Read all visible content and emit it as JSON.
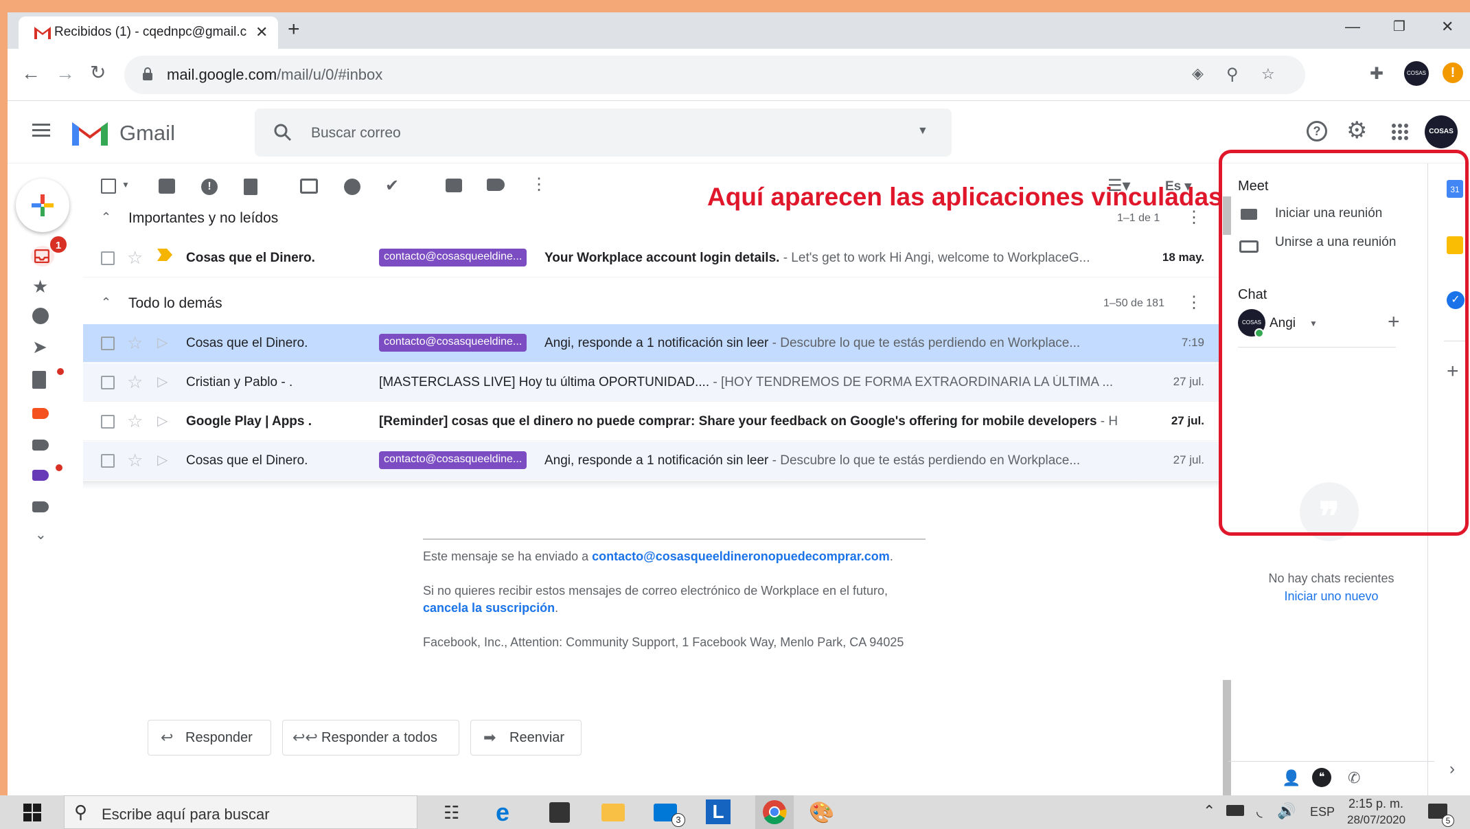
{
  "browser": {
    "tab_title": "Recibidos (1) - cqednpc@gmail.c",
    "url_host": "mail.google.com",
    "url_path": "/mail/u/0/#inbox"
  },
  "gmail": {
    "logo_text": "Gmail",
    "search_placeholder": "Buscar correo",
    "inbox_badge": "1",
    "toolbar": {
      "density_label": "Es"
    },
    "sections": [
      {
        "title": "Importantes y no leídos",
        "count": "1–1 de 1"
      },
      {
        "title": "Todo lo demás",
        "count": "1–50 de 181"
      }
    ],
    "important_rows": [
      {
        "sender": "Cosas que el Dinero.",
        "label": "contacto@cosasqueeldine...",
        "subject": "Your Workplace account login details.",
        "snippet": " - Let's get to work Hi Angi, welcome to WorkplaceG...",
        "date": "18 may."
      }
    ],
    "other_rows": [
      {
        "sender": "Cosas que el Dinero.",
        "label": "contacto@cosasqueeldine...",
        "subject": "Angi, responde a 1 notificación sin leer",
        "snippet": " - Descubre lo que te estás perdiendo en Workplace...",
        "date": "7:19"
      },
      {
        "sender": "Cristian y Pablo - .",
        "label": "",
        "subject": "[MASTERCLASS LIVE] Hoy tu última OPORTUNIDAD....",
        "snippet": " - [HOY TENDREMOS DE FORMA EXTRAORDINARIA LA ÚLTIMA ...",
        "date": "27 jul."
      },
      {
        "sender_bold": "Google Play",
        "sender_rest": " | Apps .",
        "label": "",
        "subject": "[Reminder] cosas que el dinero no puede comprar: Share your feedback on Google's offering for mobile developers",
        "snippet": " - H",
        "date": "27 jul."
      },
      {
        "sender": "Cosas que el Dinero.",
        "label": "contacto@cosasqueeldine...",
        "subject": "Angi, responde a 1 notificación sin leer",
        "snippet": " - Descubre lo que te estás perdiendo en Workplace...",
        "date": "27 jul."
      }
    ],
    "footer": {
      "sent_to_prefix": "Este mensaje se ha enviado a ",
      "sent_to_email": "contacto@cosasqueeldineronopuedecomprar.com",
      "sent_to_suffix": ".",
      "unsub_text": "Si no quieres recibir estos mensajes de correo electrónico de Workplace en el futuro, ",
      "unsub_link": "cancela la suscripción",
      "unsub_suffix": ".",
      "address": "Facebook, Inc., Attention: Community Support, 1 Facebook Way, Menlo Park, CA 94025"
    },
    "actions": {
      "reply": "Responder",
      "reply_all": "Responder a todos",
      "forward": "Reenviar"
    },
    "side": {
      "meet_title": "Meet",
      "meet_start": "Iniciar una reunión",
      "meet_join": "Unirse a una reunión",
      "chat_title": "Chat",
      "chat_user": "Angi",
      "no_chats": "No hay chats recientes",
      "start_new": "Iniciar uno nuevo"
    },
    "annotation": "Aquí aparecen las aplicaciones vinculadas",
    "avatar_text": "COSAS"
  },
  "taskbar": {
    "search_placeholder": "Escribe aquí para buscar",
    "mail_badge": "3",
    "lang": "ESP",
    "time": "2:15 p. m.",
    "date": "28/07/2020",
    "notif_badge": "5"
  }
}
